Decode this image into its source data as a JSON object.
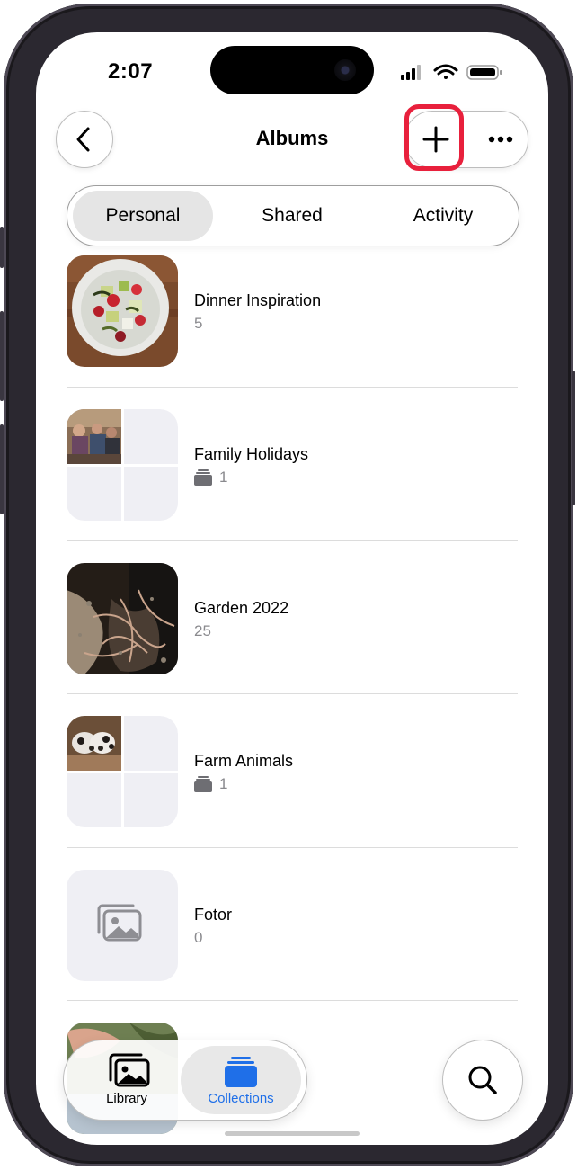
{
  "status_bar": {
    "time": "2:07"
  },
  "header": {
    "title": "Albums"
  },
  "segments": [
    {
      "label": "Personal",
      "active": true
    },
    {
      "label": "Shared",
      "active": false
    },
    {
      "label": "Activity",
      "active": false
    }
  ],
  "albums": [
    {
      "name": "Dinner Inspiration",
      "count": "5",
      "type": "album"
    },
    {
      "name": "Family Holidays",
      "count": "1",
      "type": "shared-stack"
    },
    {
      "name": "Garden 2022",
      "count": "25",
      "type": "album"
    },
    {
      "name": "Farm Animals",
      "count": "1",
      "type": "shared-stack"
    },
    {
      "name": "Fotor",
      "count": "0",
      "type": "empty"
    }
  ],
  "tabbar": {
    "library_label": "Library",
    "collections_label": "Collections",
    "active": "Collections"
  },
  "colors": {
    "accent": "#1f6fe8",
    "highlight": "#e8203c",
    "secondary_text": "#8a8a8e"
  }
}
